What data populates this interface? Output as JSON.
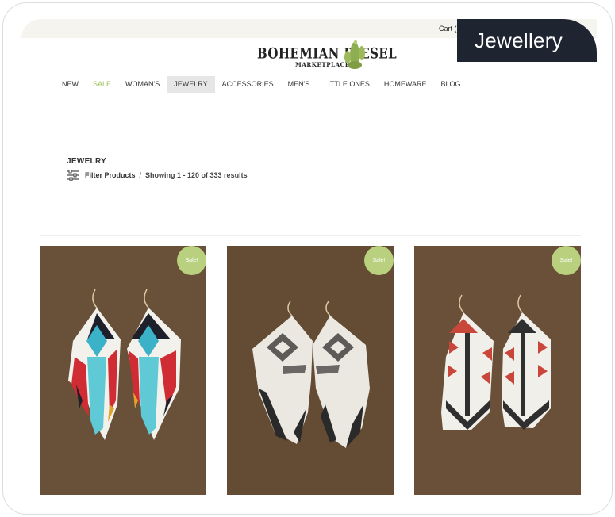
{
  "header": {
    "cart_label": "Cart (",
    "logo_text": "BOHEMIAN DIESEL",
    "logo_subtext": "MARKETPLACE"
  },
  "tag": {
    "label": "Jewellery"
  },
  "nav": {
    "items": [
      {
        "label": "NEW"
      },
      {
        "label": "SALE"
      },
      {
        "label": "WOMAN'S"
      },
      {
        "label": "JEWELRY"
      },
      {
        "label": "ACCESSORIES"
      },
      {
        "label": "MEN'S"
      },
      {
        "label": "LITTLE ONES"
      },
      {
        "label": "HOMEWARE"
      },
      {
        "label": "BLOG"
      }
    ],
    "active": "JEWELRY"
  },
  "listing": {
    "title": "JEWELRY",
    "filter_label": "Filter Products",
    "separator": "/",
    "results_text": "Showing 1 - 120 of 333 results"
  },
  "products": [
    {
      "badge": "Sale!",
      "image": "turquoise-red-beaded-fringe-earrings"
    },
    {
      "badge": "Sale!",
      "image": "white-black-beaded-fringe-earrings"
    },
    {
      "badge": "Sale!",
      "image": "white-red-arrow-beaded-earrings"
    }
  ],
  "colors": {
    "tag_bg": "#1f2530",
    "sale_green": "#9bbf57",
    "badge_green": "#b9d07e",
    "product_bg": "#6b5239",
    "topbar_bg": "#f6f4ef"
  }
}
